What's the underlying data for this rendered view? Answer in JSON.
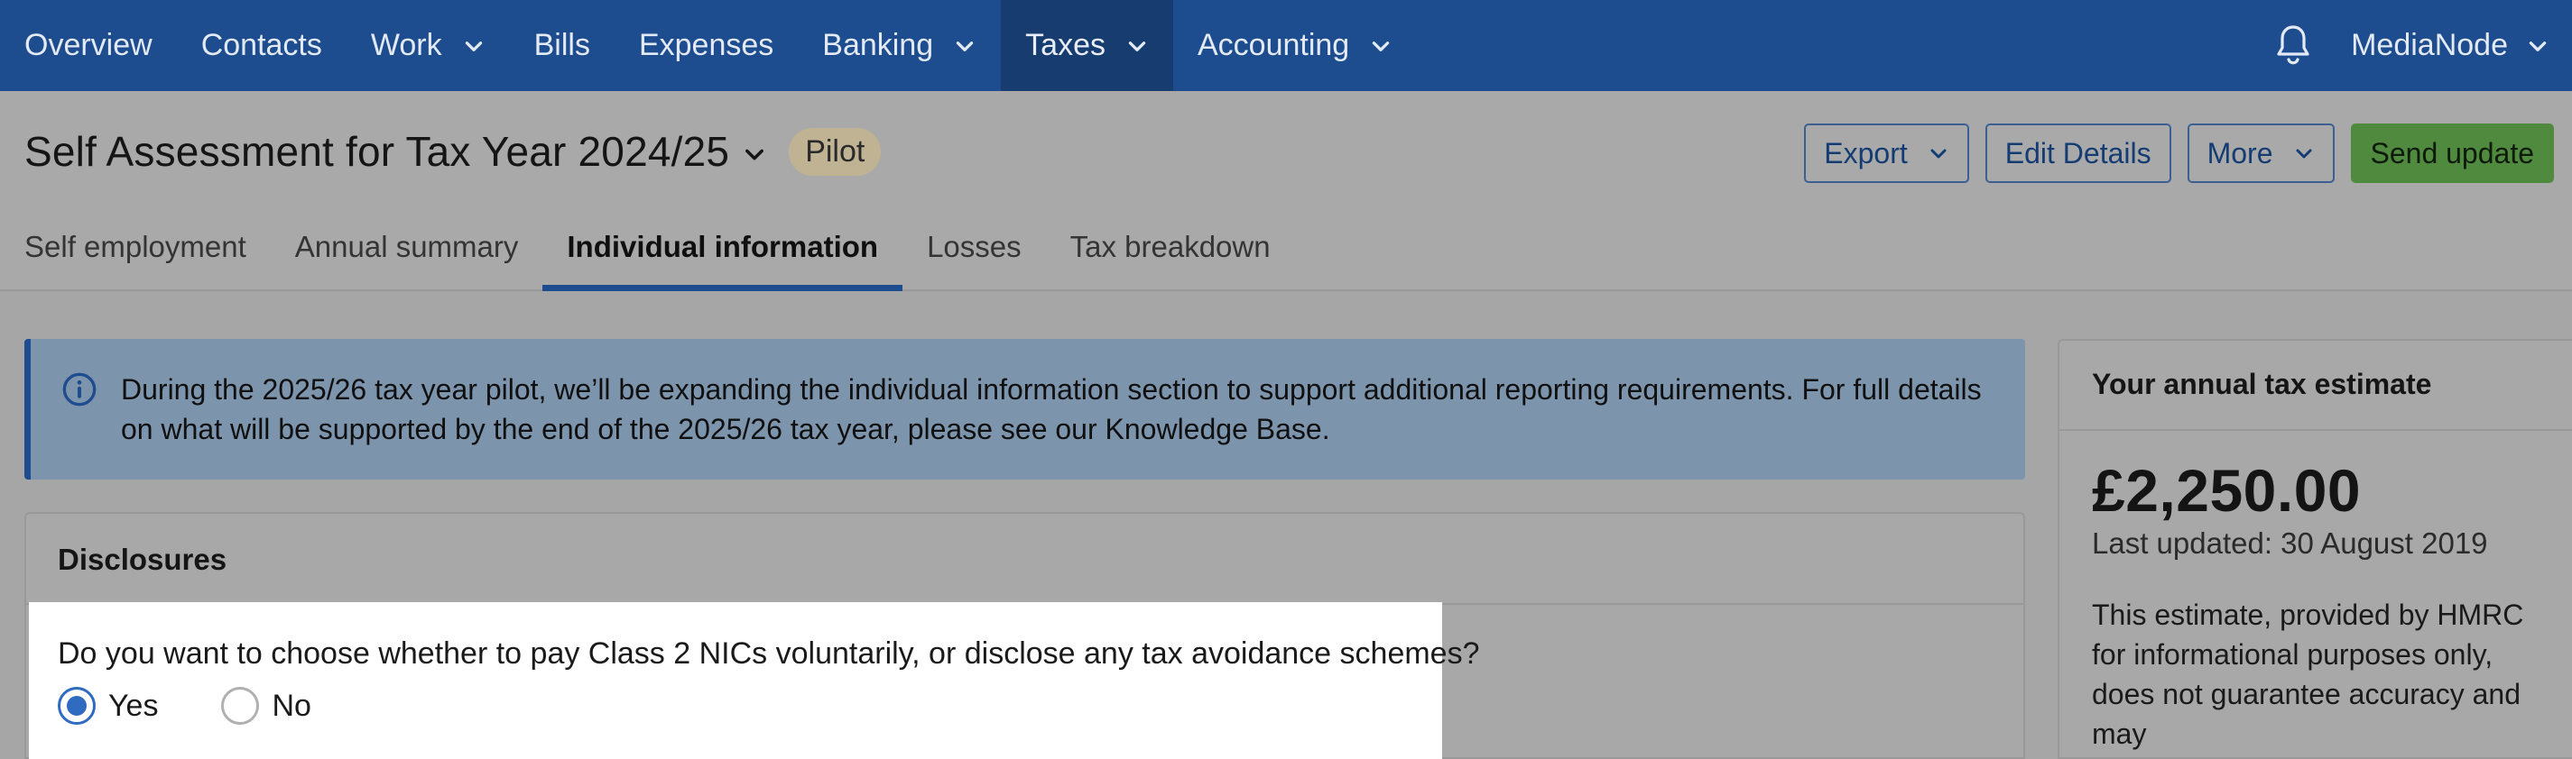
{
  "nav": {
    "items": [
      {
        "label": "Overview",
        "has_dropdown": false
      },
      {
        "label": "Contacts",
        "has_dropdown": false
      },
      {
        "label": "Work",
        "has_dropdown": true
      },
      {
        "label": "Bills",
        "has_dropdown": false
      },
      {
        "label": "Expenses",
        "has_dropdown": false
      },
      {
        "label": "Banking",
        "has_dropdown": true
      },
      {
        "label": "Taxes",
        "has_dropdown": true,
        "active": true
      },
      {
        "label": "Accounting",
        "has_dropdown": true
      }
    ],
    "notification_icon": "bell-icon",
    "account_label": "MediaNode"
  },
  "header": {
    "title": "Self Assessment for Tax Year 2024/25",
    "badge": "Pilot",
    "actions": {
      "export": "Export",
      "edit": "Edit Details",
      "more": "More",
      "send": "Send update"
    }
  },
  "tabs": [
    {
      "label": "Self employment"
    },
    {
      "label": "Annual summary"
    },
    {
      "label": "Individual information",
      "active": true
    },
    {
      "label": "Losses"
    },
    {
      "label": "Tax breakdown"
    }
  ],
  "info_banner": {
    "icon": "info-icon",
    "text": "During the 2025/26 tax year pilot, we’ll be expanding the individual information section to support additional reporting requirements. For full details on what will be supported by the end of the 2025/26 tax year, please see our Knowledge Base."
  },
  "disclosures": {
    "title": "Disclosures",
    "question": "Do you want to choose whether to pay Class 2 NICs voluntarily, or disclose any tax avoidance schemes?",
    "options": {
      "yes": "Yes",
      "no": "No"
    },
    "selected": "Yes"
  },
  "estimate": {
    "title": "Your annual tax estimate",
    "amount": "£2,250.00",
    "updated": "Last updated: 30 August 2019",
    "description": "This estimate, provided by HMRC for informational purposes only, does not guarantee accuracy and may"
  },
  "colors": {
    "nav_bg": "#1e4d8f",
    "nav_active_bg": "#173c70",
    "primary_button": "#4f8a3e",
    "radio_selected": "#2f6bc1"
  }
}
